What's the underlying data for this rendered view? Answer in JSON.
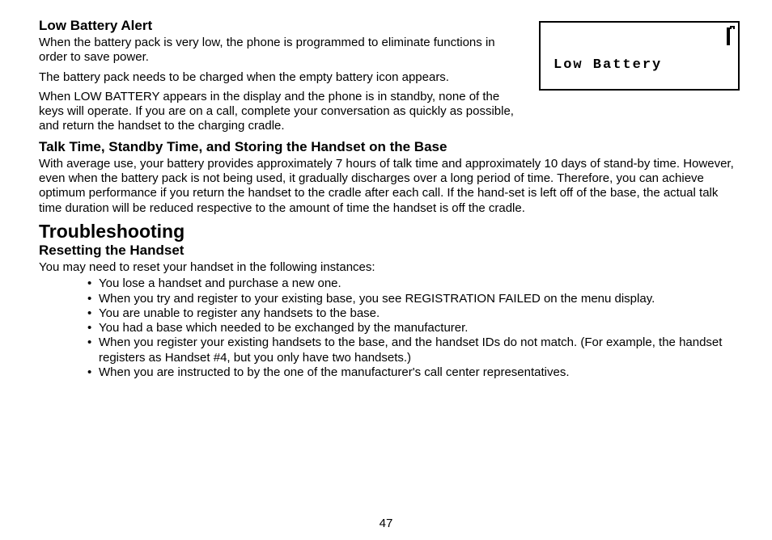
{
  "lcd": {
    "text": "Low Battery"
  },
  "section1": {
    "heading": "Low Battery Alert",
    "p1": "When the battery pack is very low, the phone is programmed to eliminate functions in order to save power.",
    "p2": "The battery pack needs to be charged when the empty battery icon appears.",
    "p3": "When LOW BATTERY appears in the display and the phone is in standby, none of the keys will operate. If you are on a call, complete your conversation as quickly as possible, and return the handset to the charging cradle."
  },
  "section2": {
    "heading": "Talk Time, Standby Time, and Storing the Handset on the Base",
    "p1": "With average use, your battery provides approximately 7 hours of talk time and approximately 10 days of stand-by time. However, even when the battery pack is not being used, it gradually discharges over a long period of time. Therefore, you can achieve optimum performance if you return the handset to the cradle after each call. If the hand-set is left off of the base, the actual talk time duration will be reduced respective to the amount of time the handset is off the cradle."
  },
  "troubleshooting": {
    "title": "Troubleshooting",
    "subheading": "Resetting the Handset",
    "intro": "You may need to reset your handset in the following instances:",
    "items": [
      "You lose a handset and purchase a new one.",
      "When you try and register to your existing base, you see REGISTRATION FAILED on the menu display.",
      "You are unable to register any handsets to the base.",
      "You had a base which needed to be exchanged by the manufacturer.",
      "When you register your existing handsets to the base, and the handset IDs do not match. (For example, the handset registers as Handset #4, but you only have two handsets.)",
      "When you are instructed to by the one of the manufacturer's call center representatives."
    ]
  },
  "page_number": "47"
}
